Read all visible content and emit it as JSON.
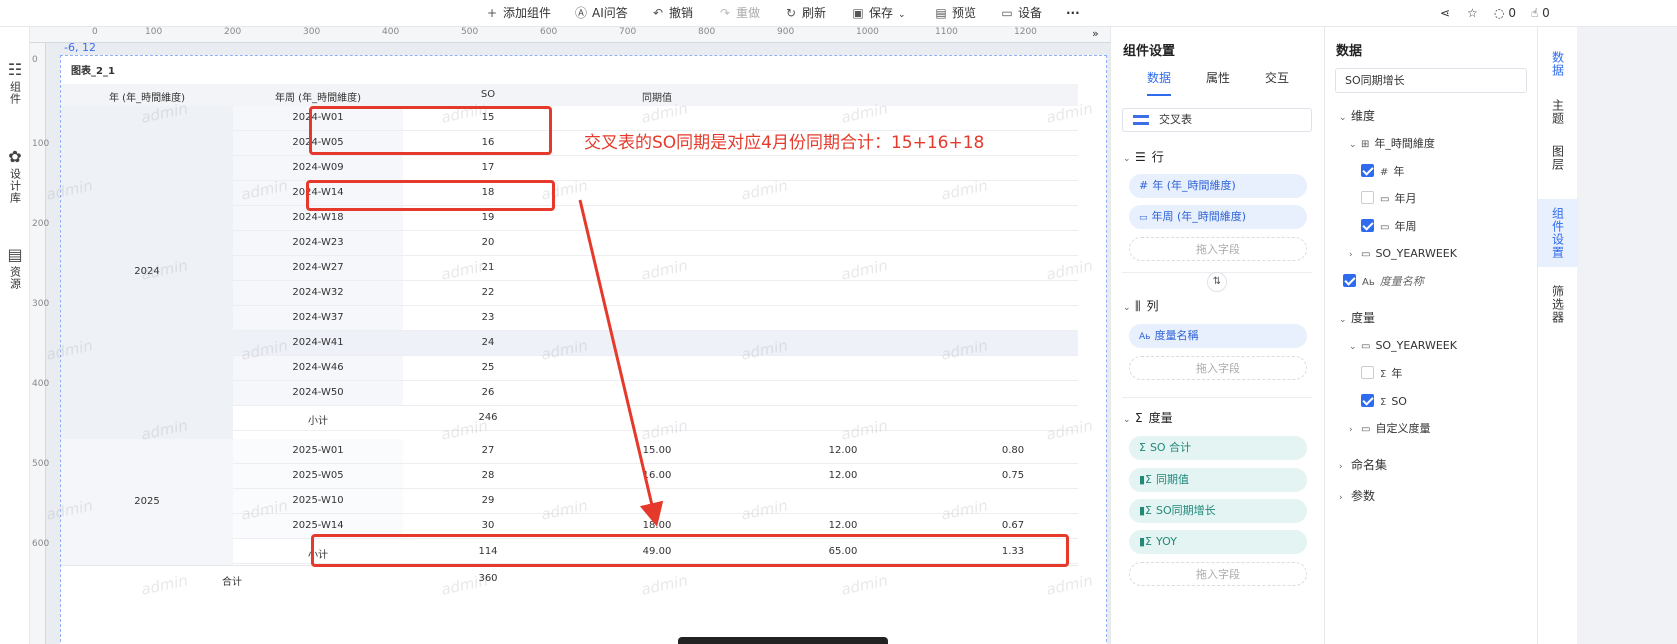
{
  "toolbar": {
    "items": [
      {
        "icon": "plus-icon",
        "label": "添加组件"
      },
      {
        "icon": "ai-icon",
        "label": "AI问答"
      },
      {
        "icon": "undo-icon",
        "label": "撤销"
      },
      {
        "icon": "redo-icon",
        "label": "重做"
      },
      {
        "icon": "refresh-icon",
        "label": "刷新"
      },
      {
        "icon": "save-icon",
        "label": "保存"
      },
      {
        "icon": "preview-icon",
        "label": "预览"
      },
      {
        "icon": "device-icon",
        "label": "设备"
      }
    ],
    "comment_count": "0",
    "like_count": "0"
  },
  "left_rail": [
    "组件",
    "设计库",
    "资源"
  ],
  "canvas": {
    "coordinate_readout": "-6, 12",
    "ruler_h": [
      "0",
      "100",
      "200",
      "300",
      "400",
      "500",
      "600",
      "700",
      "800",
      "900",
      "1000",
      "1100",
      "1200"
    ],
    "ruler_v": [
      "0",
      "100",
      "200",
      "300",
      "400",
      "500",
      "600"
    ],
    "chart_title": "图表_2_1",
    "watermark": "admin",
    "annotation": "交叉表的SO同期是对应4月份同期合计：15+16+18"
  },
  "table": {
    "headers": [
      "年 (年_時間維度)",
      "年周 (年_時間維度)",
      "SO",
      "同期值"
    ],
    "groups": [
      {
        "year": "2024",
        "rows": [
          {
            "week": "2024-W01",
            "so": "15"
          },
          {
            "week": "2024-W05",
            "so": "16"
          },
          {
            "week": "2024-W09",
            "so": "17"
          },
          {
            "week": "2024-W14",
            "so": "18"
          },
          {
            "week": "2024-W18",
            "so": "19"
          },
          {
            "week": "2024-W23",
            "so": "20"
          },
          {
            "week": "2024-W27",
            "so": "21"
          },
          {
            "week": "2024-W32",
            "so": "22"
          },
          {
            "week": "2024-W37",
            "so": "23"
          },
          {
            "week": "2024-W41",
            "so": "24"
          },
          {
            "week": "2024-W46",
            "so": "25"
          },
          {
            "week": "2024-W50",
            "so": "26"
          }
        ],
        "subtotal": {
          "label": "小计",
          "so": "246"
        }
      },
      {
        "year": "2025",
        "rows": [
          {
            "week": "2025-W01",
            "so": "27",
            "c4": "15.00",
            "c5": "12.00",
            "c6": "0.80"
          },
          {
            "week": "2025-W05",
            "so": "28",
            "c4": "16.00",
            "c5": "12.00",
            "c6": "0.75"
          },
          {
            "week": "2025-W10",
            "so": "29"
          },
          {
            "week": "2025-W14",
            "so": "30",
            "c4": "18.00",
            "c5": "12.00",
            "c6": "0.67"
          }
        ],
        "subtotal": {
          "label": "小计",
          "so": "114",
          "c4": "49.00",
          "c5": "65.00",
          "c6": "1.33"
        }
      }
    ],
    "total": {
      "label": "合计",
      "so": "360"
    }
  },
  "settings": {
    "title": "组件设置",
    "tabs": [
      "数据",
      "属性",
      "交互"
    ],
    "chart_type": "交叉表",
    "rows_title": "行",
    "rows": [
      "年 (年_時間維度)",
      "年周 (年_時間維度)"
    ],
    "drop_hint": "拖入字段",
    "cols_title": "列",
    "cols": [
      "度量名稱"
    ],
    "measures_title": "度量",
    "measures": [
      "SO 合计",
      "同期值",
      "SO同期增长",
      "YOY"
    ]
  },
  "data_panel": {
    "title": "数据",
    "search_value": "SO同期增长",
    "dimension_title": "维度",
    "dim_group": "年_時間維度",
    "dim_items": [
      {
        "label": "年",
        "checked": true,
        "type": "#"
      },
      {
        "label": "年月",
        "checked": false,
        "type": "date"
      },
      {
        "label": "年周",
        "checked": true,
        "type": "date"
      }
    ],
    "dim_folder": "SO_YEARWEEK",
    "measure_name": "度量名称",
    "measure_title": "度量",
    "mea_group": "SO_YEARWEEK",
    "mea_items": [
      {
        "label": "年",
        "checked": false
      },
      {
        "label": "SO",
        "checked": true
      }
    ],
    "custom_measure": "自定义度量",
    "named_sets": "命名集",
    "params": "参数"
  },
  "right_tabs": [
    "数据",
    "主题",
    "图层",
    "组件设置",
    "筛选器"
  ]
}
